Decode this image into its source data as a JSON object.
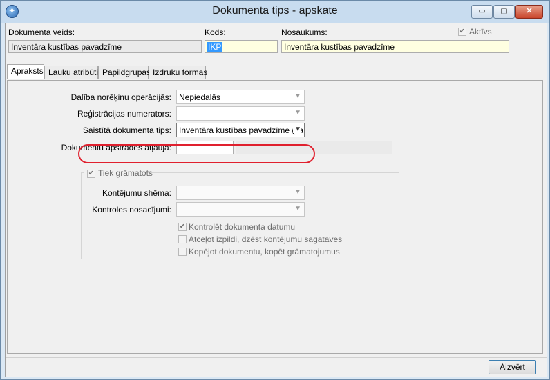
{
  "window": {
    "title": "Dokumenta tips - apskate",
    "controls": {
      "minimize": "▭",
      "maximize": "▢",
      "close": "✕"
    }
  },
  "header": {
    "doc_type_label": "Dokumenta veids:",
    "doc_type_value": "Inventāra kustības pavadzīme",
    "code_label": "Kods:",
    "code_value": "IKP",
    "name_label": "Nosaukums:",
    "name_value": "Inventāra kustības pavadzīme",
    "active_label": "Aktīvs",
    "active_checked": true
  },
  "tabs": [
    {
      "label": "Apraksts",
      "active": true
    },
    {
      "label": "Lauku atribūti",
      "active": false
    },
    {
      "label": "Papildgrupas",
      "active": false
    },
    {
      "label": "Izdruku formas",
      "active": false
    }
  ],
  "form": {
    "settlement_label": "Dalība norēķinu operācijās:",
    "settlement_value": "Nepiedalās",
    "numerator_label": "Reģistrācijas numerators:",
    "numerator_value": "",
    "linked_doc_label": "Saistītā dokumenta tips:",
    "linked_doc_value": "Inventāra kustības pavadzīme (sa",
    "permission_label": "Dokumentu apstrādes atļauja:",
    "permission_code": "",
    "permission_name": ""
  },
  "accounting": {
    "group_label": "Tiek grāmatots",
    "group_checked": true,
    "scheme_label": "Kontējumu shēma:",
    "scheme_value": "",
    "conditions_label": "Kontroles nosacījumi:",
    "conditions_value": "",
    "check_date_label": "Kontrolēt dokumenta datumu",
    "check_date_checked": true,
    "cancel_label": "Atceļot izpildi, dzēst kontējumu sagataves",
    "cancel_checked": false,
    "copy_label": "Kopējot dokumentu, kopēt grāmatojumus",
    "copy_checked": false
  },
  "footer": {
    "close_button": "Aizvērt"
  },
  "colors": {
    "highlight_ellipse": "#e0202e",
    "yellow_field": "#ffffe1",
    "selection": "#3399ff"
  }
}
